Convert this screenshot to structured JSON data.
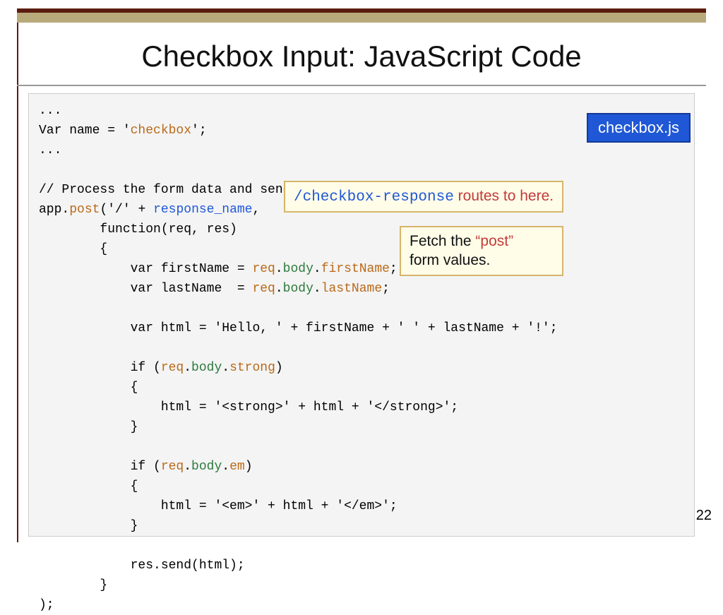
{
  "title": "Checkbox Input: JavaScript Code",
  "filename_badge": "checkbox.js",
  "page_number": "22",
  "callouts": {
    "route_mono": "/checkbox-response",
    "route_rest": " routes to here.",
    "fetch_line1a": "Fetch the ",
    "fetch_line1b": "“post”",
    "fetch_line2": "form values."
  },
  "code": {
    "l01": "...",
    "l02a": "Var name = '",
    "l02b": "checkbox",
    "l02c": "';",
    "l03": "...",
    "l04": "",
    "l05": "// Process the form data and send a response.",
    "l06a": "app.",
    "l06b": "post",
    "l06c": "('/' + ",
    "l06d": "response_name",
    "l06e": ",",
    "l07": "        function(req, res)",
    "l08": "        {",
    "l09a": "            var firstName = ",
    "l09b": "req",
    "l09c": ".",
    "l09d": "body",
    "l09e": ".",
    "l09f": "firstName",
    "l09g": ";",
    "l10a": "            var lastName  = ",
    "l10b": "req",
    "l10c": ".",
    "l10d": "body",
    "l10e": ".",
    "l10f": "lastName",
    "l10g": ";",
    "l11": "",
    "l12": "            var html = 'Hello, ' + firstName + ' ' + lastName + '!';",
    "l13": "",
    "l14a": "            if (",
    "l14b": "req",
    "l14c": ".",
    "l14d": "body",
    "l14e": ".",
    "l14f": "strong",
    "l14g": ")",
    "l15": "            {",
    "l16": "                html = '<strong>' + html + '</strong>';",
    "l17": "            }",
    "l18": "",
    "l19a": "            if (",
    "l19b": "req",
    "l19c": ".",
    "l19d": "body",
    "l19e": ".",
    "l19f": "em",
    "l19g": ")",
    "l20": "            {",
    "l21": "                html = '<em>' + html + '</em>';",
    "l22": "            }",
    "l23": "",
    "l24": "            res.send(html);",
    "l25": "        }",
    "l26": ");"
  }
}
